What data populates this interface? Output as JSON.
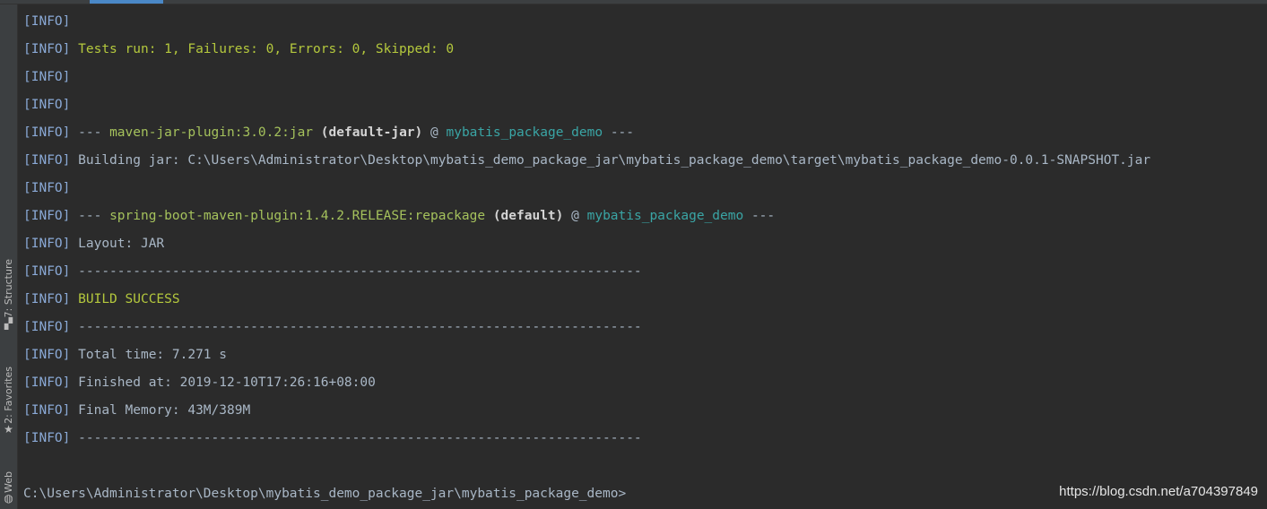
{
  "side_tabs": [
    {
      "label": "7: Structure",
      "icon": "structure-icon",
      "glyph": "▞"
    },
    {
      "label": "2: Favorites",
      "icon": "star-icon",
      "glyph": "★"
    },
    {
      "label": "Web",
      "icon": "globe-icon",
      "glyph": "◍"
    }
  ],
  "console": {
    "tag": "[INFO]",
    "tests_run": "Tests run: 1, Failures: 0, Errors: 0, Skipped: 0",
    "jar_plugin": {
      "prefix": "---",
      "plugin": "maven-jar-plugin:3.0.2:jar",
      "execution": "(default-jar)",
      "at": "@",
      "artifact": "mybatis_package_demo",
      "suffix": "---"
    },
    "building_jar": "Building jar: C:\\Users\\Administrator\\Desktop\\mybatis_demo_package_jar\\mybatis_package_demo\\target\\mybatis_package_demo-0.0.1-SNAPSHOT.jar",
    "boot_plugin": {
      "prefix": "---",
      "plugin": "spring-boot-maven-plugin:1.4.2.RELEASE:repackage",
      "execution": "(default)",
      "at": "@",
      "artifact": "mybatis_package_demo",
      "suffix": "---"
    },
    "layout": "Layout: JAR",
    "separator": "------------------------------------------------------------------------",
    "build_success": "BUILD SUCCESS",
    "total_time": "Total time: 7.271 s",
    "finished_at": "Finished at: 2019-12-10T17:26:16+08:00",
    "final_memory": "Final Memory: 43M/389M",
    "prompt": "C:\\Users\\Administrator\\Desktop\\mybatis_demo_package_jar\\mybatis_package_demo>"
  },
  "watermark": "https://blog.csdn.net/a704397849",
  "colors": {
    "background": "#2b2b2b",
    "text": "#a9b7c6",
    "tag": "#8aa9d6",
    "success": "#b4c83d",
    "plugin": "#a5c25c",
    "artifact": "#3aa5a5"
  }
}
